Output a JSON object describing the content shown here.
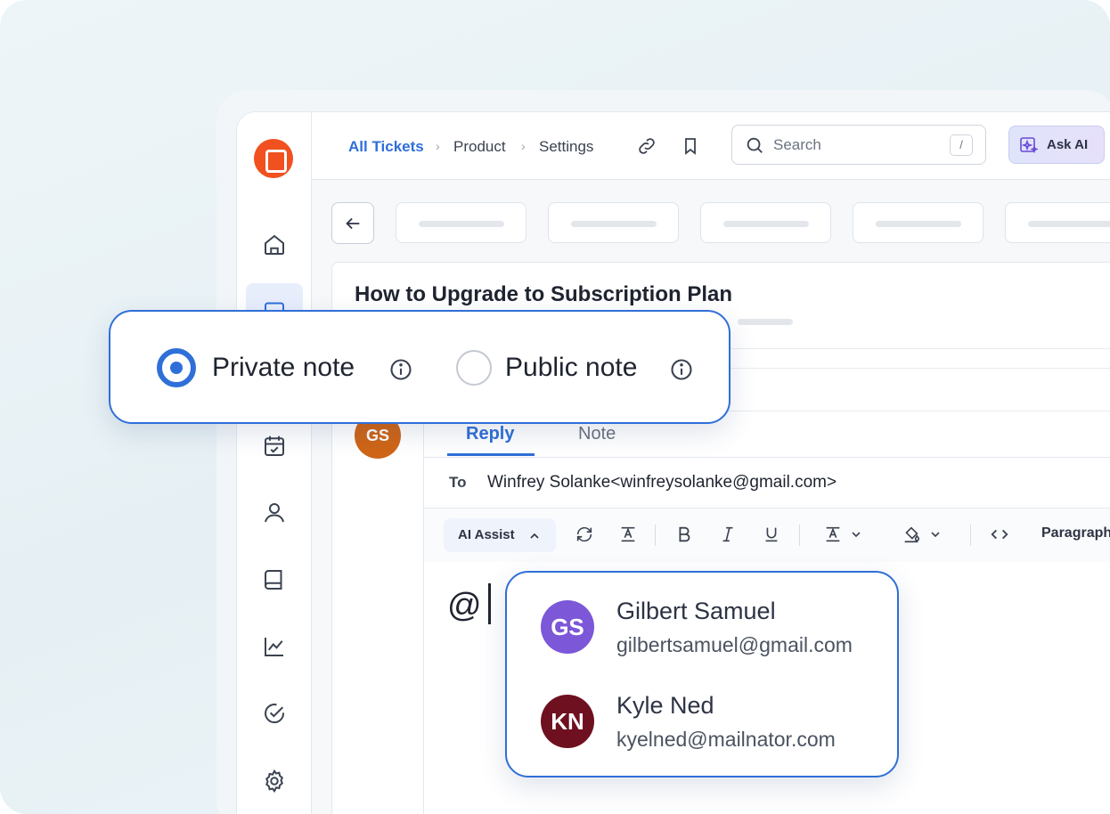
{
  "breadcrumb": {
    "item1": "All Tickets",
    "item2": "Product",
    "item3": "Settings"
  },
  "search": {
    "placeholder": "Search",
    "shortcut": "/"
  },
  "ask_ai": {
    "label": "Ask AI"
  },
  "ticket": {
    "title": "How to Upgrade to Subscription Plan"
  },
  "note_type": {
    "private_label": "Private note",
    "public_label": "Public note",
    "selected": "Private note"
  },
  "composer": {
    "avatar_initials": "GS",
    "tab_reply": "Reply",
    "tab_note": "Note",
    "active_tab": "Reply",
    "to_label": "To",
    "to_value": "Winfrey Solanke<winfreysolanke@gmail.com>",
    "ai_assist_label": "AI Assist",
    "paragraph_label": "Paragraph",
    "body_text": "@"
  },
  "mentions": [
    {
      "initials": "GS",
      "name": "Gilbert Samuel",
      "email": "gilbertsamuel@gmail.com",
      "color": "#7c57d8"
    },
    {
      "initials": "KN",
      "name": "Kyle Ned",
      "email": "kyelned@mailnator.com",
      "color": "#6e1020"
    }
  ],
  "colors": {
    "accent": "#2f6fd8",
    "brand": "#f0511f",
    "gs_small": "#cf6516"
  }
}
